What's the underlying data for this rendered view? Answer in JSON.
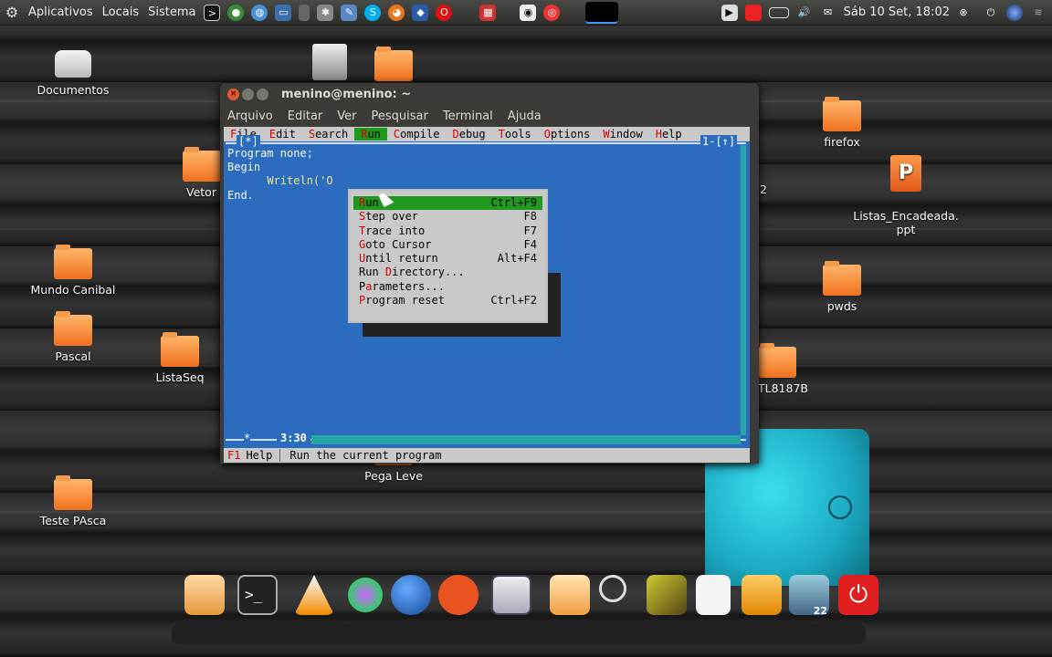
{
  "top_panel": {
    "menus": [
      "Aplicativos",
      "Locais",
      "Sistema"
    ],
    "clock": "Sáb 10 Set, 18:02",
    "launchers": [
      "terminal-icon",
      "users-icon",
      "browser-icon",
      "monitor-icon",
      "phone-icon",
      "settings-icon",
      "edit-icon",
      "skype-icon",
      "firefox-icon",
      "virtualbox-icon",
      "opera-icon",
      "package-icon",
      "stats-icon",
      "chrome-icon",
      "screen-icon"
    ],
    "tray": [
      "clapper-icon",
      "record-icon",
      "battery-icon",
      "volume-icon",
      "mail-icon",
      "close-icon",
      "power-icon",
      "globe-icon",
      "wifi-icon"
    ]
  },
  "desktop": {
    "icons": [
      {
        "label": "Documentos",
        "type": "drive"
      },
      {
        "label": "Vetor",
        "type": "folder"
      },
      {
        "label": "Mundo Canibal",
        "type": "folder"
      },
      {
        "label": "Pascal",
        "type": "folder"
      },
      {
        "label": "ListaSeq",
        "type": "folder"
      },
      {
        "label": "Teste PAsca",
        "type": "folder"
      },
      {
        "label": "Pega Leve",
        "type": "folder"
      },
      {
        "label": "firefox",
        "type": "folder"
      },
      {
        "label": "Listas_Encadeada.\nppt",
        "type": "ppt"
      },
      {
        "label": "pwds",
        "type": "folder"
      },
      {
        "label": "TL8187B",
        "type": "folder"
      },
      {
        "label": "2",
        "type": "text"
      }
    ]
  },
  "terminal": {
    "title": "menino@menino: ~",
    "menu": [
      "Arquivo",
      "Editar",
      "Ver",
      "Pesquisar",
      "Terminal",
      "Ajuda"
    ]
  },
  "ide": {
    "menu": [
      {
        "hot": "F",
        "rest": "ile"
      },
      {
        "hot": "E",
        "rest": "dit"
      },
      {
        "hot": "S",
        "rest": "earch"
      },
      {
        "hot": "R",
        "rest": "un"
      },
      {
        "hot": "C",
        "rest": "ompile"
      },
      {
        "hot": "D",
        "rest": "ebug"
      },
      {
        "hot": "T",
        "rest": "ools"
      },
      {
        "hot": "O",
        "rest": "ptions"
      },
      {
        "hot": "W",
        "rest": "indow"
      },
      {
        "hot": "H",
        "rest": "elp"
      }
    ],
    "window_marker": "[*]",
    "window_number": "1-[↑]",
    "code": [
      "Program none;",
      "Begin",
      "      Writeln('O",
      "End."
    ],
    "cursor_pos": "3:30",
    "frame_corner": "*",
    "status_key": "F1",
    "status_help": "Help",
    "status_message": "Run the current program",
    "run_menu": [
      {
        "label_hot": "R",
        "label_rest": "un",
        "shortcut": "Ctrl+F9",
        "selected": true
      },
      {
        "label_hot": "S",
        "label_rest": "tep over",
        "shortcut": "F8"
      },
      {
        "label_hot": "T",
        "label_rest": "race into",
        "shortcut": "F7"
      },
      {
        "label_hot": "G",
        "label_rest": "oto Cursor",
        "shortcut": "F4"
      },
      {
        "label_hot": "U",
        "label_rest": "ntil return",
        "shortcut": "Alt+F4"
      },
      {
        "label_pre": "Run ",
        "label_hot": "D",
        "label_rest": "irectory...",
        "shortcut": ""
      },
      {
        "label_pre": "P",
        "label_hot": "a",
        "label_rest": "rameters...",
        "shortcut": ""
      },
      {
        "label_hot": "P",
        "label_rest": "rogram reset",
        "shortcut": "Ctrl+F2"
      }
    ]
  },
  "dock": {
    "items": [
      "gimp-icon",
      "terminal-icon",
      "vlc-icon",
      "network-icon",
      "globe-icon",
      "ubuntu-icon",
      "window-icon",
      "files-icon",
      "search-icon",
      "image-icon",
      "text-editor-icon",
      "edit-icon",
      "recycle-icon",
      "power-icon"
    ],
    "recycle_badge": "22"
  }
}
